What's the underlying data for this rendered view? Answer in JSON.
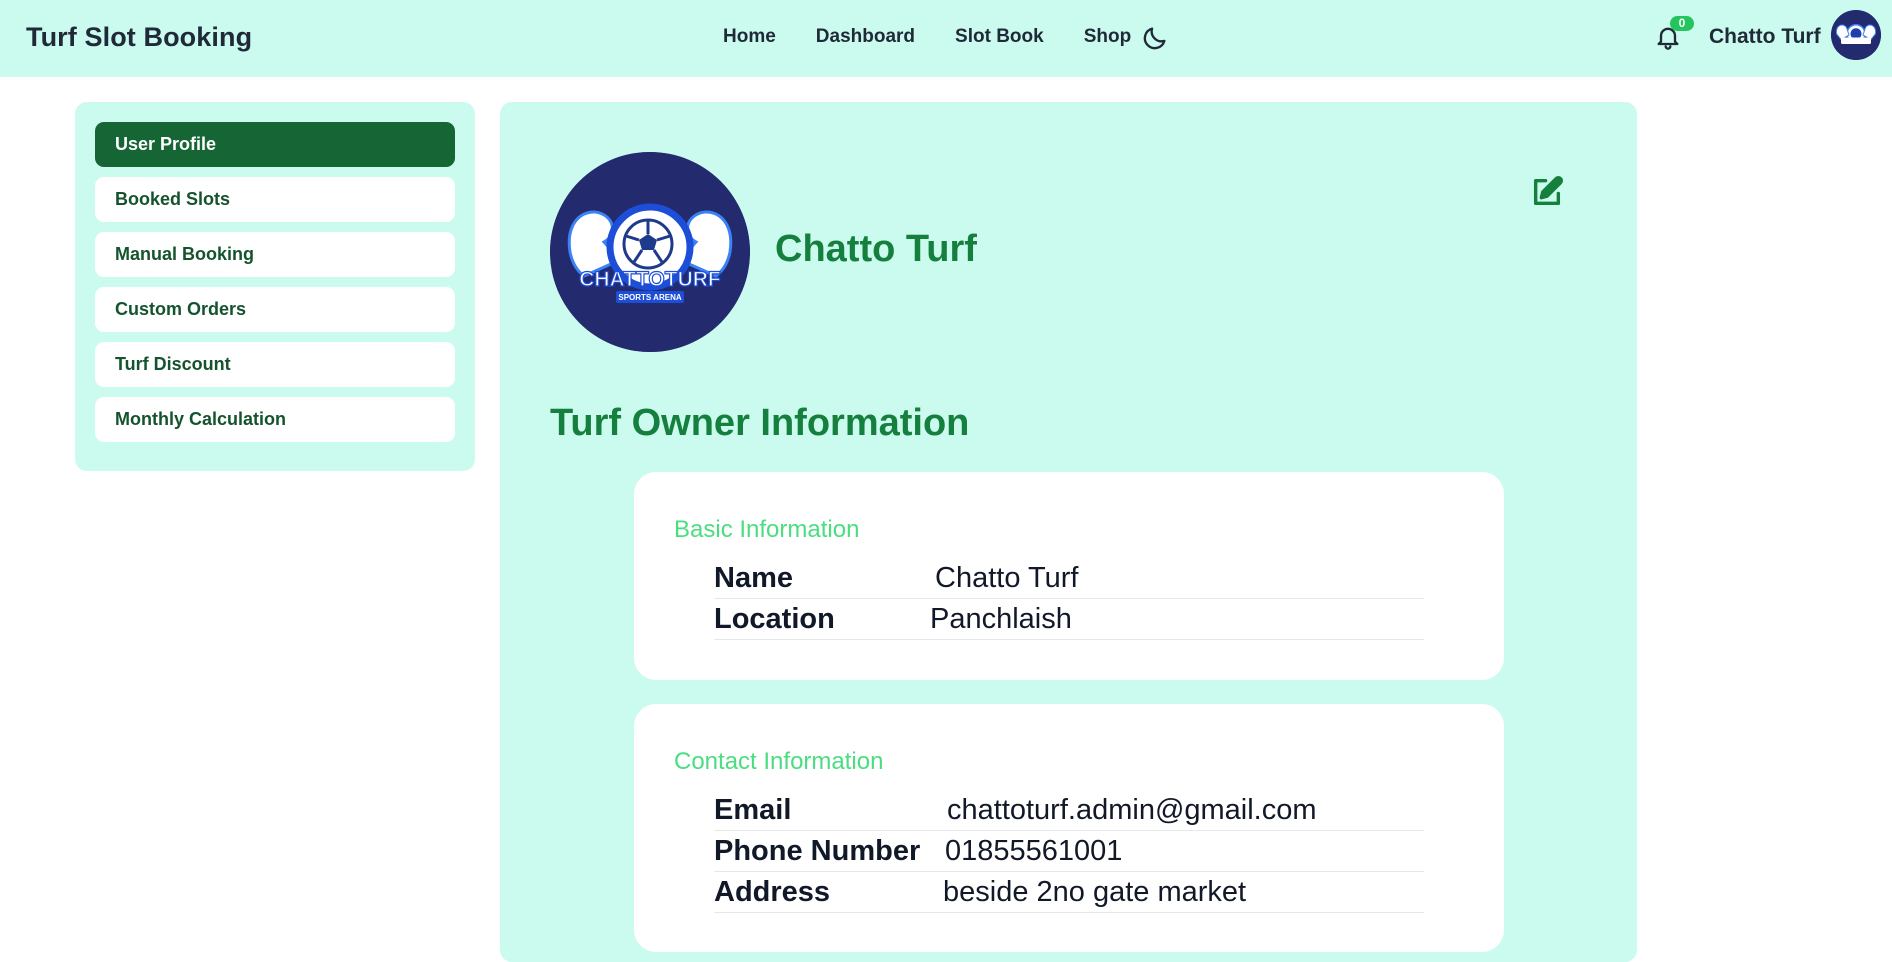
{
  "navbar": {
    "brand": "Turf Slot Booking",
    "links": [
      "Home",
      "Dashboard",
      "Slot Book",
      "Shop"
    ],
    "theme_toggle_icon": "moon-icon",
    "notification_icon": "bell-icon",
    "notification_count": "0",
    "user_name": "Chatto Turf",
    "accent": "#cbfaef"
  },
  "sidebar": {
    "items": [
      {
        "label": "User Profile",
        "active": true
      },
      {
        "label": "Booked Slots",
        "active": false
      },
      {
        "label": "Manual Booking",
        "active": false
      },
      {
        "label": "Custom Orders",
        "active": false
      },
      {
        "label": "Turf Discount",
        "active": false
      },
      {
        "label": "Monthly Calculation",
        "active": false
      }
    ],
    "active_color": "#166534"
  },
  "profile": {
    "name": "Chatto Turf",
    "logo_text": "CHATTOTURF",
    "logo_subtext": "SPORTS ARENA",
    "edit_icon": "edit-icon",
    "section_title": "Turf Owner Information",
    "basic": {
      "title": "Basic Information",
      "rows": [
        {
          "label": "Name",
          "value": "Chatto Turf"
        },
        {
          "label": "Location",
          "value": "Panchlaish"
        }
      ]
    },
    "contact": {
      "title": "Contact Information",
      "rows": [
        {
          "label": "Email",
          "value": "chattoturf.admin@gmail.com"
        },
        {
          "label": "Phone Number",
          "value": "01855561001"
        },
        {
          "label": "Address",
          "value": "beside 2no gate market"
        }
      ]
    },
    "heading_color": "#15803d",
    "card_title_color": "#4ade80"
  }
}
